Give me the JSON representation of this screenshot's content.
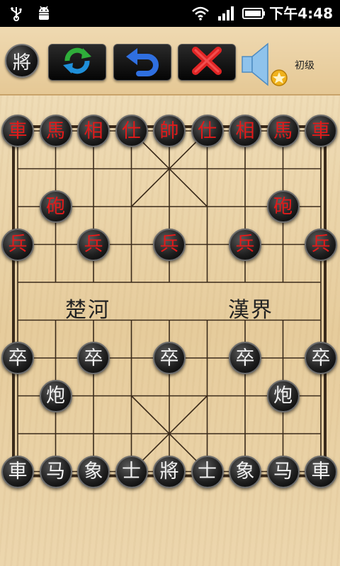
{
  "status_bar": {
    "time": "下午4:48",
    "icons": [
      "usb-icon",
      "android-debug-icon",
      "wifi-icon",
      "signal-icon",
      "battery-icon"
    ]
  },
  "toolbar": {
    "general_label": "將",
    "level_label": "初级",
    "buttons": [
      "refresh-icon",
      "undo-icon",
      "close-icon",
      "speaker-icon"
    ]
  },
  "board": {
    "river_left": "楚河",
    "river_right": "漢界",
    "pieces": [
      {
        "char": "車",
        "side": "red",
        "col": 0,
        "row": 0
      },
      {
        "char": "馬",
        "side": "red",
        "col": 1,
        "row": 0
      },
      {
        "char": "相",
        "side": "red",
        "col": 2,
        "row": 0
      },
      {
        "char": "仕",
        "side": "red",
        "col": 3,
        "row": 0
      },
      {
        "char": "帥",
        "side": "red",
        "col": 4,
        "row": 0
      },
      {
        "char": "仕",
        "side": "red",
        "col": 5,
        "row": 0
      },
      {
        "char": "相",
        "side": "red",
        "col": 6,
        "row": 0
      },
      {
        "char": "馬",
        "side": "red",
        "col": 7,
        "row": 0
      },
      {
        "char": "車",
        "side": "red",
        "col": 8,
        "row": 0
      },
      {
        "char": "砲",
        "side": "red",
        "col": 1,
        "row": 2
      },
      {
        "char": "砲",
        "side": "red",
        "col": 7,
        "row": 2
      },
      {
        "char": "兵",
        "side": "red",
        "col": 0,
        "row": 3
      },
      {
        "char": "兵",
        "side": "red",
        "col": 2,
        "row": 3
      },
      {
        "char": "兵",
        "side": "red",
        "col": 4,
        "row": 3
      },
      {
        "char": "兵",
        "side": "red",
        "col": 6,
        "row": 3
      },
      {
        "char": "兵",
        "side": "red",
        "col": 8,
        "row": 3
      },
      {
        "char": "卒",
        "side": "black",
        "col": 0,
        "row": 6
      },
      {
        "char": "卒",
        "side": "black",
        "col": 2,
        "row": 6
      },
      {
        "char": "卒",
        "side": "black",
        "col": 4,
        "row": 6
      },
      {
        "char": "卒",
        "side": "black",
        "col": 6,
        "row": 6
      },
      {
        "char": "卒",
        "side": "black",
        "col": 8,
        "row": 6
      },
      {
        "char": "炮",
        "side": "black",
        "col": 1,
        "row": 7
      },
      {
        "char": "炮",
        "side": "black",
        "col": 7,
        "row": 7
      },
      {
        "char": "車",
        "side": "black",
        "col": 0,
        "row": 9
      },
      {
        "char": "马",
        "side": "black",
        "col": 1,
        "row": 9
      },
      {
        "char": "象",
        "side": "black",
        "col": 2,
        "row": 9
      },
      {
        "char": "士",
        "side": "black",
        "col": 3,
        "row": 9
      },
      {
        "char": "將",
        "side": "black",
        "col": 4,
        "row": 9
      },
      {
        "char": "士",
        "side": "black",
        "col": 5,
        "row": 9
      },
      {
        "char": "象",
        "side": "black",
        "col": 6,
        "row": 9
      },
      {
        "char": "马",
        "side": "black",
        "col": 7,
        "row": 9
      },
      {
        "char": "車",
        "side": "black",
        "col": 8,
        "row": 9
      }
    ]
  },
  "colors": {
    "red_piece_text": "#e01b1b",
    "black_piece_text": "#f2f2f2",
    "board_wood": "#e8cfa3",
    "grid_line": "#3a2a1a"
  }
}
